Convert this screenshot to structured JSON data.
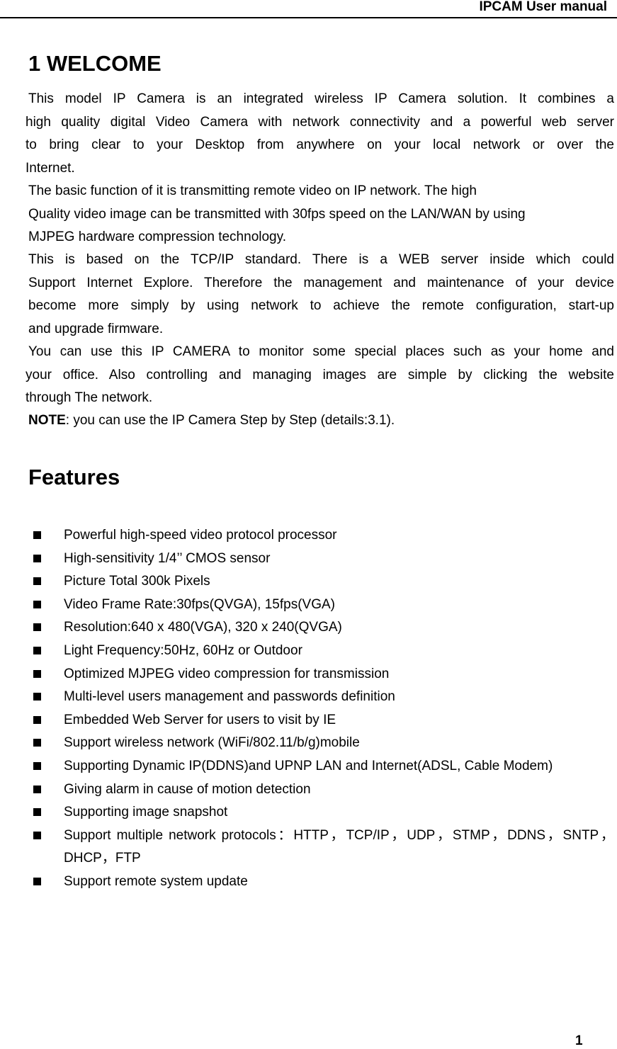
{
  "header": {
    "title": "IPCAM User manual"
  },
  "section": {
    "heading": "1 WELCOME"
  },
  "paragraphs": {
    "intro": [
      "This model IP Camera is an integrated wireless IP Camera solution. It combines a",
      "high quality digital Video Camera with network connectivity and a powerful web server",
      "to bring clear to your Desktop from anywhere on your local network or over the",
      "Internet."
    ],
    "basic": [
      "The basic function of it is transmitting remote video on IP network. The high",
      "Quality video image can be transmitted with 30fps speed on the LAN/WAN by using",
      "MJPEG hardware compression technology."
    ],
    "tcpip": [
      "This is based on the TCP/IP standard. There is a WEB server inside which could",
      "Support Internet Explore. Therefore the management and maintenance of your device",
      "become more simply by using network to achieve the remote configuration, start-up",
      "and upgrade firmware."
    ],
    "usage": [
      "You can use this IP CAMERA to monitor some special places such as your home and",
      "your office. Also controlling and managing images are simple by clicking the website",
      "through The network."
    ],
    "note": {
      "label": "NOTE",
      "text": ": you can use the IP Camera Step by Step (details:3.1)."
    }
  },
  "features": {
    "heading": "Features",
    "items": [
      "Powerful high-speed video protocol processor",
      "High-sensitivity 1/4’’ CMOS sensor",
      "Picture Total 300k Pixels",
      "Video Frame Rate:30fps(QVGA), 15fps(VGA)",
      "Resolution:640 x 480(VGA), 320 x 240(QVGA)",
      "Light Frequency:50Hz, 60Hz or Outdoor",
      "Optimized MJPEG video compression for transmission",
      "Multi-level users management and passwords definition",
      "Embedded Web Server for users to visit by IE",
      "Support wireless network (WiFi/802.11/b/g)mobile",
      "Supporting Dynamic IP(DDNS)and UPNP LAN and Internet(ADSL, Cable Modem)",
      "Giving alarm in cause of motion detection",
      "Supporting image snapshot",
      "Support multiple network protocols：HTTP，TCP/IP，UDP，STMP，DDNS，SNTP，DHCP，FTP",
      "Support remote system update"
    ]
  },
  "footer": {
    "page_number": "1"
  }
}
